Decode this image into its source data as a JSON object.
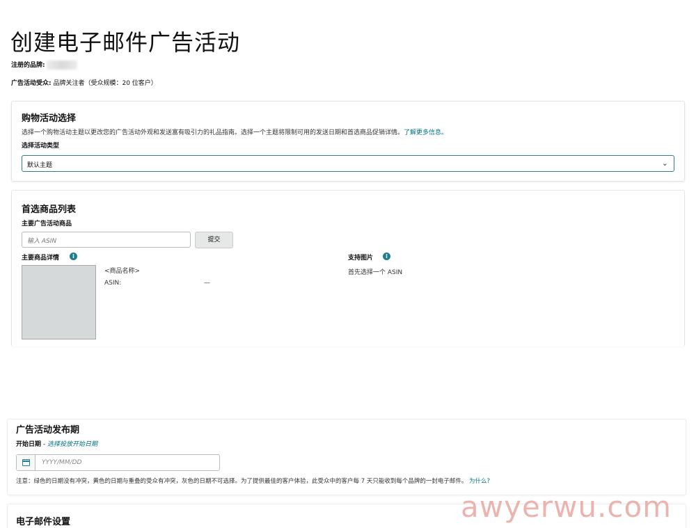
{
  "header": {
    "title": "创建电子邮件广告活动",
    "brand_label": "注册的品牌:",
    "audience_label": "广告活动受众:",
    "audience_value": "品牌关注者（受众规模：20 位客户）"
  },
  "shopping": {
    "heading": "购物活动选择",
    "description": "选择一个购物活动主题以更改您的广告活动外观和发送富有吸引力的礼品指南。选择一个主题将限制可用的发送日期和首选商品促销详情。",
    "learn_more": "了解更多信息。",
    "type_label": "选择活动类型",
    "selected_type": "默认主题"
  },
  "products": {
    "heading": "首选商品列表",
    "main_product_label": "主要广告活动商品",
    "asin_placeholder": "输入 ASIN",
    "submit_label": "提交",
    "details_label": "主要商品详情",
    "product_name": "<商品名称>",
    "asin_label": "ASIN:",
    "asin_value": "—",
    "support_images_label": "支持图片",
    "support_images_hint": "首先选择一个 ASIN"
  },
  "schedule": {
    "heading": "广告活动发布期",
    "start_date_label": "开始日期",
    "start_date_sep": " - ",
    "start_date_hint": "选择投放开始日期",
    "date_placeholder": "YYYY/MM/DD",
    "note": "注意：绿色的日期没有冲突，黄色的日期与重叠的受众有冲突，灰色的日期不可选择。为了提供最佳的客户体验，此受众中的客户每 7 天只能收到每个品牌的一封电子邮件。",
    "why_link": "为什么?"
  },
  "email_settings": {
    "heading": "电子邮件设置"
  },
  "watermark": "awyerwu.com",
  "colors": {
    "accent": "#007185",
    "info_icon": "#1f7d8c",
    "watermark": "#e8a7a1"
  }
}
